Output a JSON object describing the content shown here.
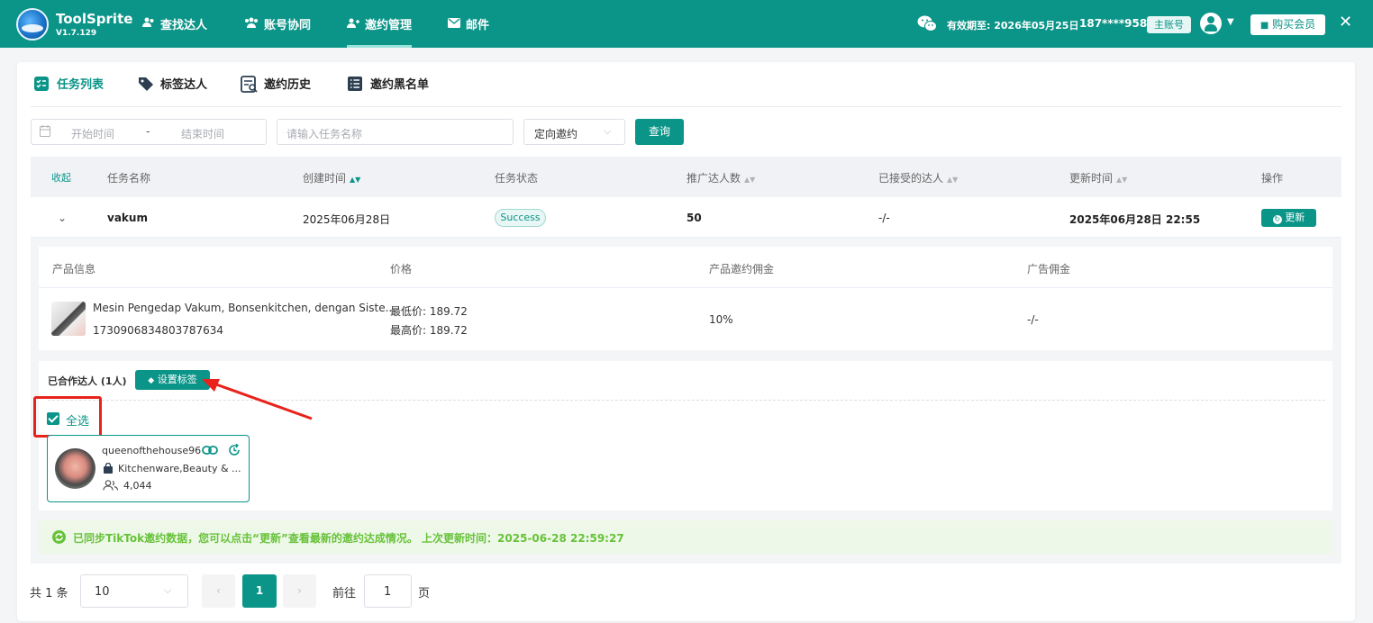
{
  "app": {
    "name": "ToolSprite",
    "version": "V1.7.129"
  },
  "nav": [
    {
      "label": "查找达人",
      "icon": "users-icon"
    },
    {
      "label": "账号协同",
      "icon": "group-icon"
    },
    {
      "label": "邀约管理",
      "icon": "invite-icon",
      "active": true
    },
    {
      "label": "邮件",
      "icon": "mail-icon"
    }
  ],
  "header": {
    "valid_until": "有效期至: 2026年05月25日",
    "phone": "187****9589",
    "main_account": "主账号",
    "buy_label": "购买会员",
    "close": "✕"
  },
  "tabs": [
    {
      "label": "任务列表",
      "active": true
    },
    {
      "label": "标签达人"
    },
    {
      "label": "邀约历史"
    },
    {
      "label": "邀约黑名单"
    }
  ],
  "filters": {
    "start_placeholder": "开始时间",
    "sep": "-",
    "end_placeholder": "结束时间",
    "task_placeholder": "请输入任务名称",
    "type_value": "定向邀约",
    "query_label": "查询"
  },
  "table": {
    "headers": {
      "collapse": "收起",
      "name": "任务名称",
      "created": "创建时间",
      "status": "任务状态",
      "promoted": "推广达人数",
      "accepted": "已接受的达人",
      "updated": "更新时间",
      "action": "操作"
    },
    "row": {
      "name": "vakum",
      "created": "2025年06月28日",
      "status": "Success",
      "promoted": "50",
      "accepted": "-/-",
      "updated": "2025年06月28日 22:55",
      "action_label": "更新"
    }
  },
  "product": {
    "headers": {
      "info": "产品信息",
      "price": "价格",
      "commission": "产品邀约佣金",
      "ad": "广告佣金"
    },
    "title": "Mesin Pengedap Vakum, Bonsenkitchen, dengan Siste...",
    "id": "1730906834803787634",
    "min_price": "最低价: 189.72",
    "max_price": "最高价: 189.72",
    "commission": "10%",
    "ad": "-/-"
  },
  "cooperation": {
    "title": "已合作达人 (1人)",
    "set_tag_label": "设置标签",
    "select_all": "全选",
    "creator": {
      "name": "queenofthehouse96",
      "category": "Kitchenware,Beauty & ...",
      "followers": "4,044"
    }
  },
  "notice": "已同步TikTok邀约数据，您可以点击“更新”查看最新的邀约达成情况。 上次更新时间：2025-06-28 22:59:27",
  "pagination": {
    "total": "共 1 条",
    "page_size": "10",
    "current": "1",
    "goto_label": "前往",
    "goto_value": "1",
    "page_unit": "页"
  },
  "colors": {
    "primary": "#0b9488",
    "success": "#67c23a",
    "highlight": "#e8231b"
  }
}
